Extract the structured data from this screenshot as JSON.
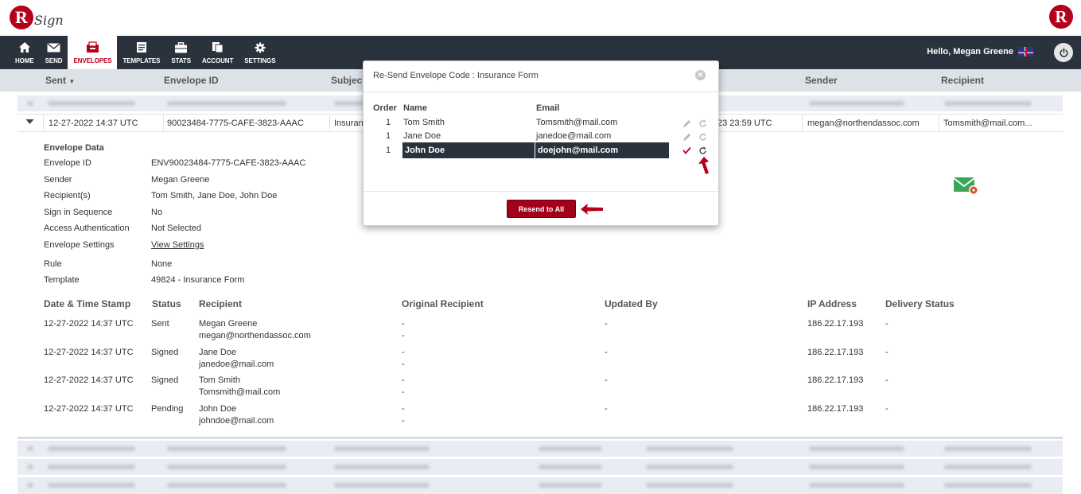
{
  "app": {
    "logo_letter": "R",
    "logo_word": "Sign",
    "brand_right_letter": "R",
    "greeting": "Hello, Megan Greene"
  },
  "nav": {
    "items": [
      {
        "label": "HOME",
        "icon": "home-icon"
      },
      {
        "label": "SEND",
        "icon": "envelope-icon"
      },
      {
        "label": "ENVELOPES",
        "icon": "inbox-icon",
        "active": true
      },
      {
        "label": "TEMPLATES",
        "icon": "document-icon"
      },
      {
        "label": "STATS",
        "icon": "briefcase-icon"
      },
      {
        "label": "ACCOUNT",
        "icon": "files-icon"
      },
      {
        "label": "SETTINGS",
        "icon": "gear-icon"
      }
    ]
  },
  "table": {
    "headers": {
      "sent": "Sent",
      "envelope_id": "Envelope ID",
      "subject": "Subject",
      "sender": "Sender",
      "recipient": "Recipient"
    },
    "expanded_row": {
      "sent": "12-27-2022 14:37 UTC",
      "envelope_id": "90023484-7775-CAFE-3823-AAAC",
      "subject": "Insuran",
      "expiry_fragment": "23 23:59 UTC",
      "sender": "megan@northendassoc.com",
      "recipient": "Tomsmith@mail.com..."
    }
  },
  "details": {
    "heading": "Envelope Data",
    "fields": [
      {
        "label": "Envelope ID",
        "value": "ENV90023484-7775-CAFE-3823-AAAC"
      },
      {
        "label": "Sender",
        "value": "Megan Greene"
      },
      {
        "label": "Recipient(s)",
        "value": "Tom Smith, Jane Doe, John Doe"
      },
      {
        "label": "Sign in Sequence",
        "value": "No"
      },
      {
        "label": "Access Authentication",
        "value": "Not Selected"
      },
      {
        "label": "Envelope Settings",
        "value": "View Settings"
      },
      {
        "label": "Rule",
        "value": "None"
      },
      {
        "label": "Template",
        "value": "49824 - Insurance Form"
      }
    ]
  },
  "history": {
    "headers": {
      "date": "Date & Time Stamp",
      "status": "Status",
      "recipient": "Recipient",
      "original_recipient": "Original Recipient",
      "updated_by": "Updated By",
      "ip": "IP Address",
      "delivery": "Delivery Status"
    },
    "rows": [
      {
        "date": "12-27-2022 14:37 UTC",
        "status": "Sent",
        "name": "Megan Greene",
        "email": "megan@northendassoc.com",
        "orig1": "-",
        "orig2": "-",
        "updated": "-",
        "ip": "186.22.17.193",
        "delivery": "-"
      },
      {
        "date": "12-27-2022 14:37 UTC",
        "status": "Signed",
        "name": "Jane Doe",
        "email": "janedoe@mail.com",
        "orig1": "-",
        "orig2": "-",
        "updated": "-",
        "ip": "186.22.17.193",
        "delivery": "-"
      },
      {
        "date": "12-27-2022 14:37 UTC",
        "status": "Signed",
        "name": "Tom Smith",
        "email": "Tomsmith@mail.com",
        "orig1": "-",
        "orig2": "-",
        "updated": "-",
        "ip": "186.22.17.193",
        "delivery": "-"
      },
      {
        "date": "12-27-2022 14:37 UTC",
        "status": "Pending",
        "name": "John Doe",
        "email": "johndoe@mail.com",
        "orig1": "-",
        "orig2": "-",
        "updated": "-",
        "ip": "186.22.17.193",
        "delivery": "-"
      }
    ]
  },
  "modal": {
    "title": "Re-Send Envelope Code : Insurance Form",
    "headers": {
      "order": "Order",
      "name": "Name",
      "email": "Email"
    },
    "rows": [
      {
        "order": "1",
        "name": "Tom Smith",
        "email": "Tomsmith@mail.com"
      },
      {
        "order": "1",
        "name": "Jane Doe",
        "email": "janedoe@mail.com"
      }
    ],
    "edit_row": {
      "order": "1",
      "name": "John Doe",
      "email": "doejohn@mail.com"
    },
    "resend_button": "Resend to All"
  },
  "colors": {
    "brand_red": "#b3001b",
    "nav_bg": "#2a333d",
    "button_red": "#a3001a"
  }
}
